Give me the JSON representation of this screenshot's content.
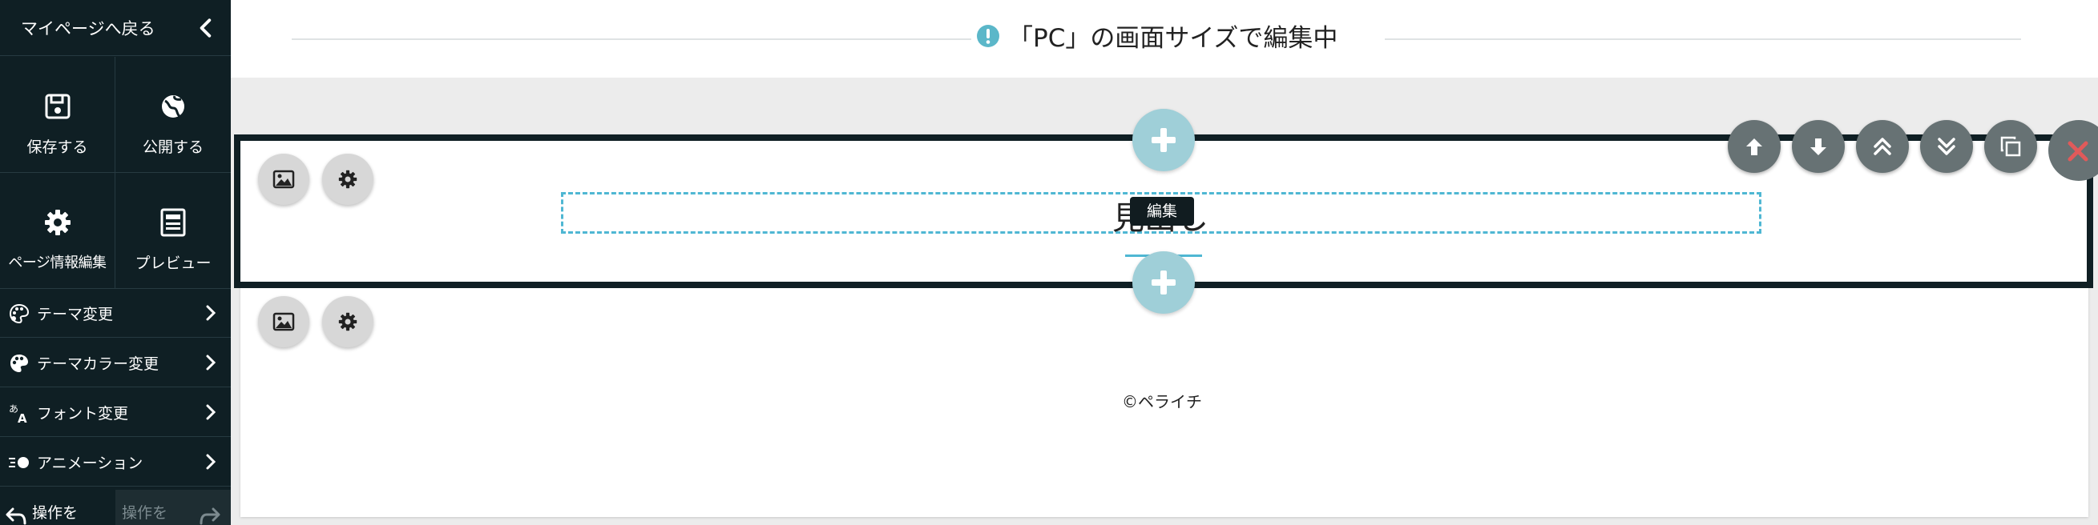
{
  "sidebar": {
    "back_label": "マイページへ戻る",
    "tiles": [
      {
        "label": "保存する",
        "icon": "save-icon"
      },
      {
        "label": "公開する",
        "icon": "globe-icon"
      },
      {
        "label": "ページ情報編集",
        "icon": "gear-icon"
      },
      {
        "label": "プレビュー",
        "icon": "preview-icon"
      }
    ],
    "menu": [
      {
        "label": "テーマ変更",
        "icon": "palette-icon"
      },
      {
        "label": "テーマカラー変更",
        "icon": "color-palette-icon"
      },
      {
        "label": "フォント変更",
        "icon": "font-icon"
      },
      {
        "label": "アニメーション",
        "icon": "animation-icon"
      }
    ],
    "undo_label": "操作を",
    "redo_label": "操作を"
  },
  "banner": {
    "text": "「PC」の画面サイズで編集中",
    "icon": "exclamation-circle-icon",
    "icon_color": "#5bb7c9"
  },
  "editor": {
    "heading_text": "見出し",
    "tooltip": "編集",
    "copyright": "©ペライチ",
    "accent_color": "#4fb7d3",
    "toolbar": [
      "arrow-up-icon",
      "arrow-down-icon",
      "double-chevron-up-icon",
      "double-chevron-down-icon",
      "copy-icon",
      "close-icon"
    ]
  }
}
